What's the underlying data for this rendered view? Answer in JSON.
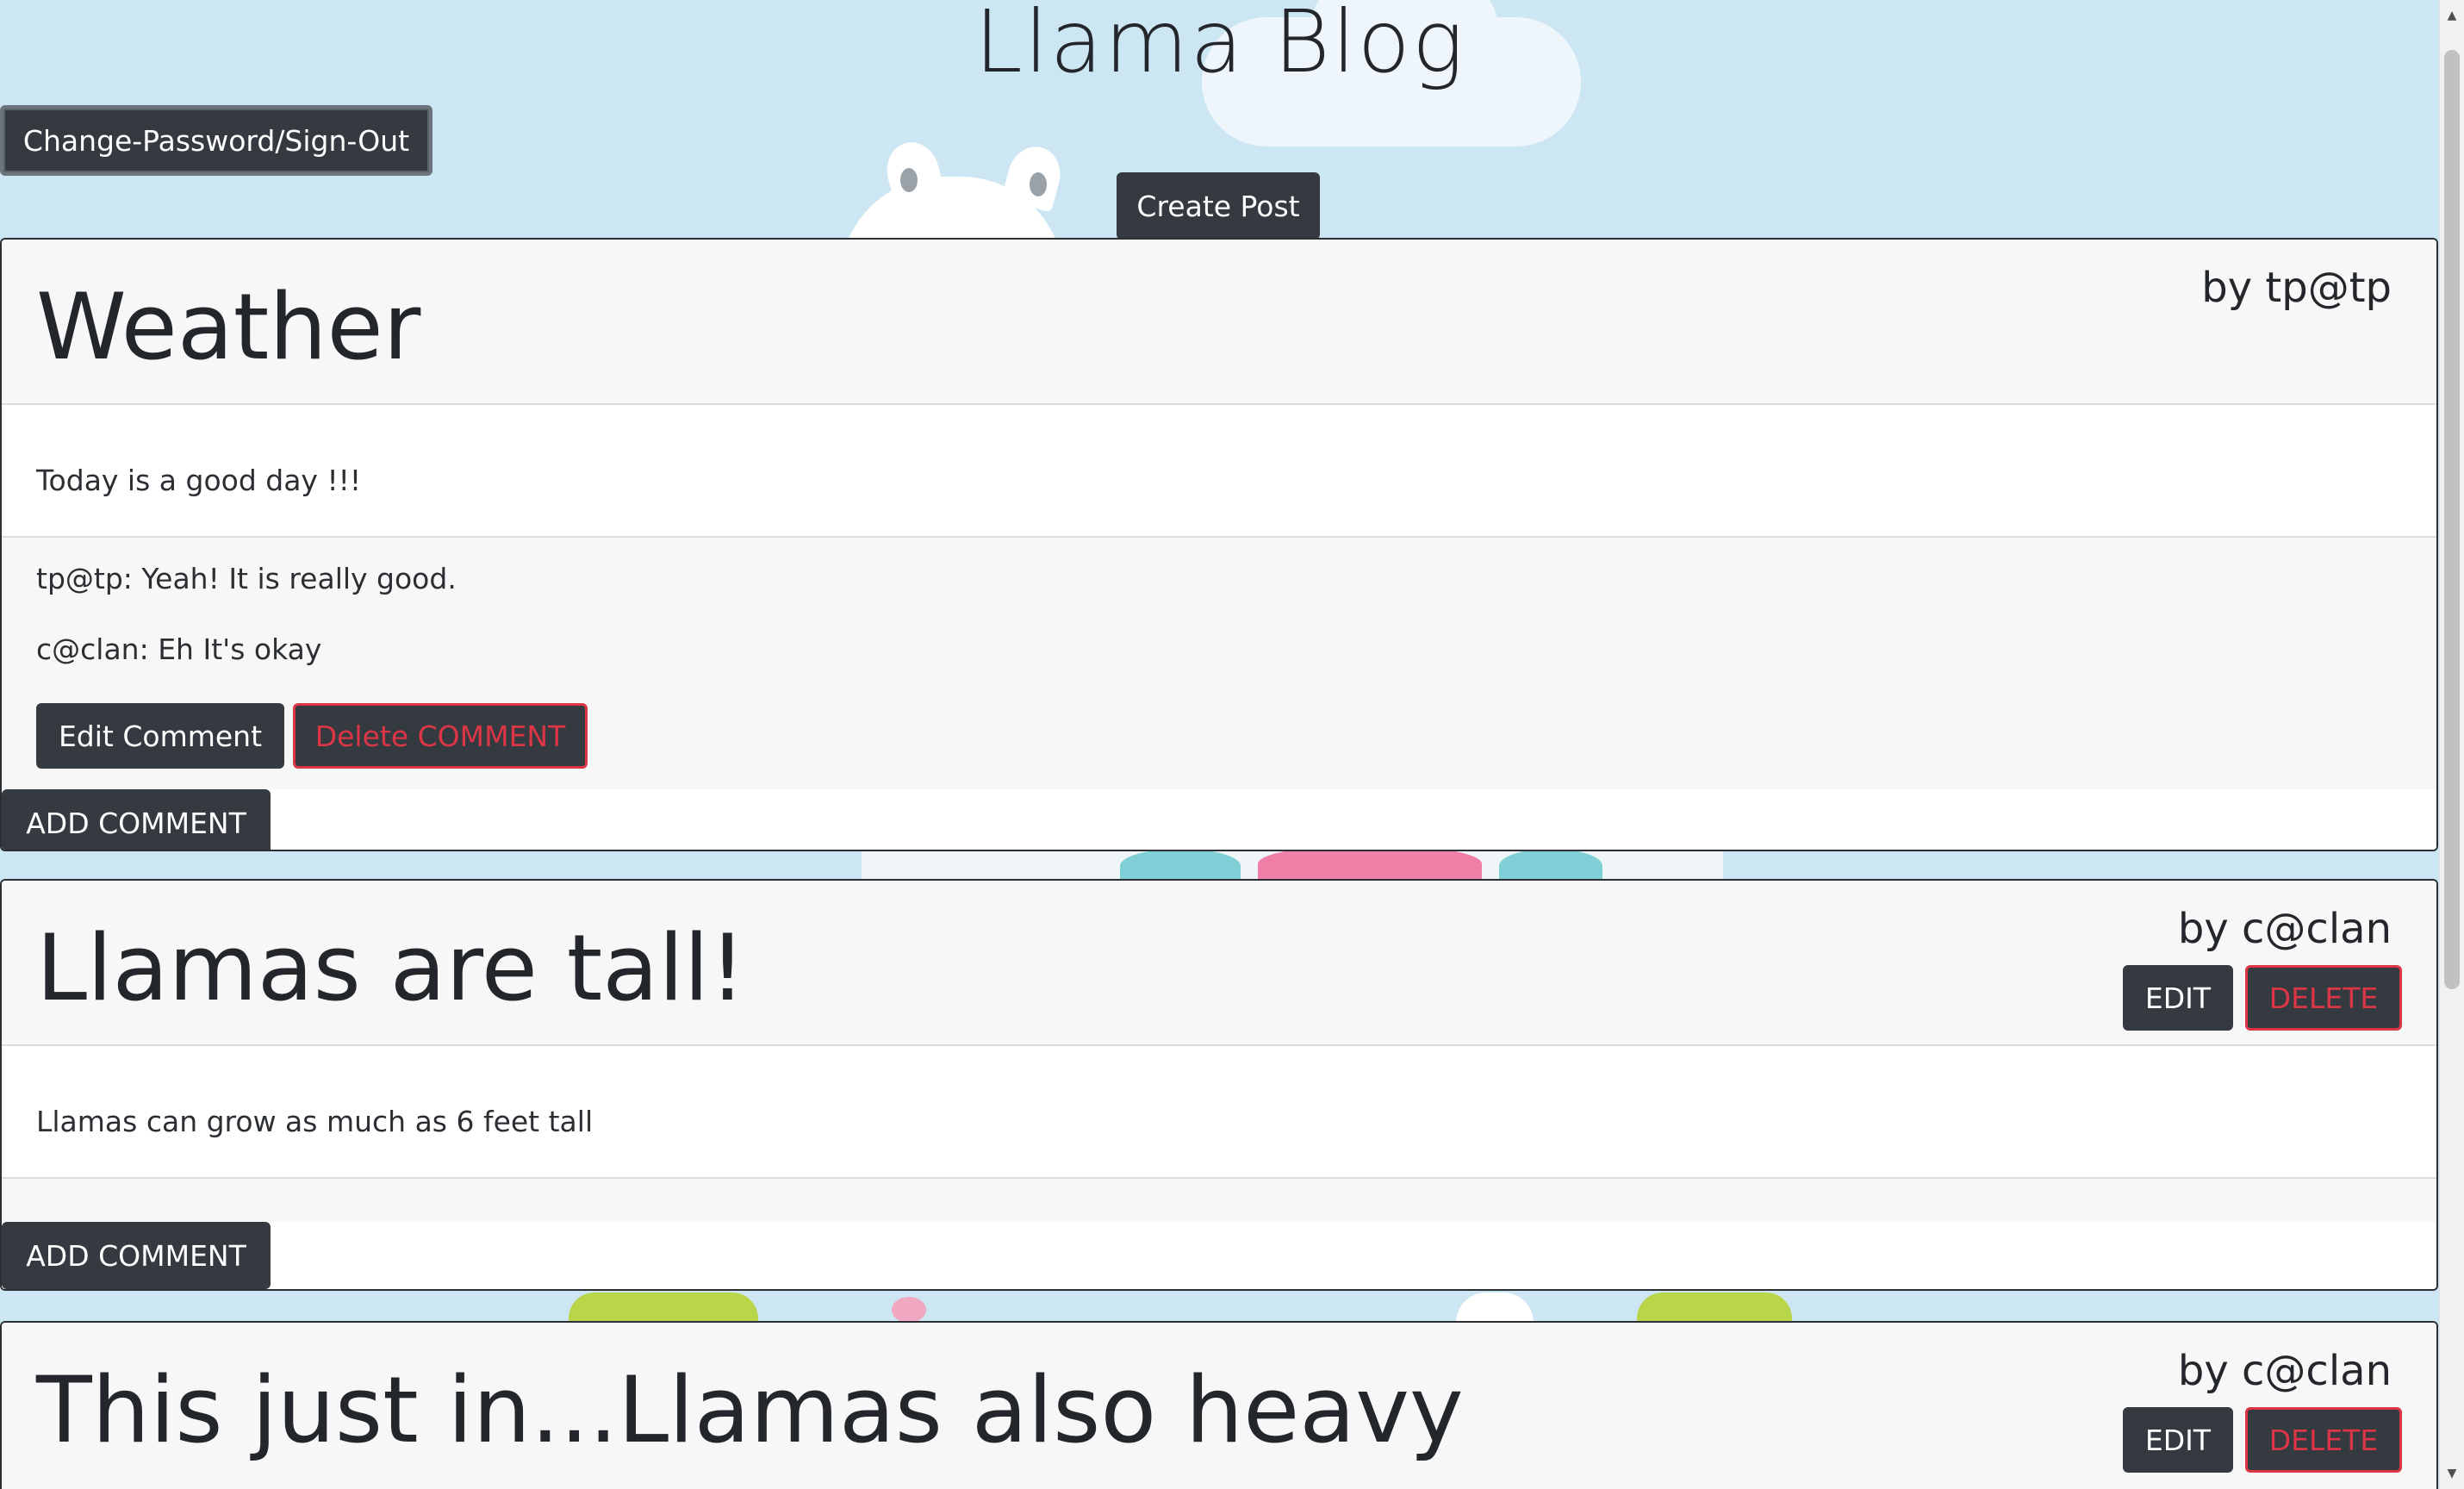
{
  "header": {
    "title": "Llama Blog",
    "account_button": "Change-Password/Sign-Out",
    "create_post_button": "Create Post"
  },
  "posts": [
    {
      "title": "Weather",
      "author": "by tp@tp",
      "body": "Today is a good day !!!",
      "comments": [
        "tp@tp: Yeah! It is really good.",
        "c@clan: Eh It's okay"
      ],
      "edit_comment_button": "Edit Comment",
      "delete_comment_button": "Delete COMMENT",
      "add_comment_button": "ADD COMMENT"
    },
    {
      "title": "Llamas are tall!",
      "author": "by c@clan",
      "edit_button": "EDIT",
      "delete_button": "DELETE",
      "body": "Llamas can grow as much as 6 feet tall",
      "add_comment_button": "ADD COMMENT"
    },
    {
      "title": "This just in...Llamas also heavy",
      "author": "by c@clan",
      "edit_button": "EDIT",
      "delete_button": "DELETE"
    }
  ],
  "scrollbar": {
    "up_icon": "arrow-up-icon",
    "down_icon": "arrow-down-icon"
  },
  "colors": {
    "background": "#cde6f3",
    "button_dark": "#343a40",
    "danger": "#dc3545",
    "card_header": "#f7f7f7"
  }
}
